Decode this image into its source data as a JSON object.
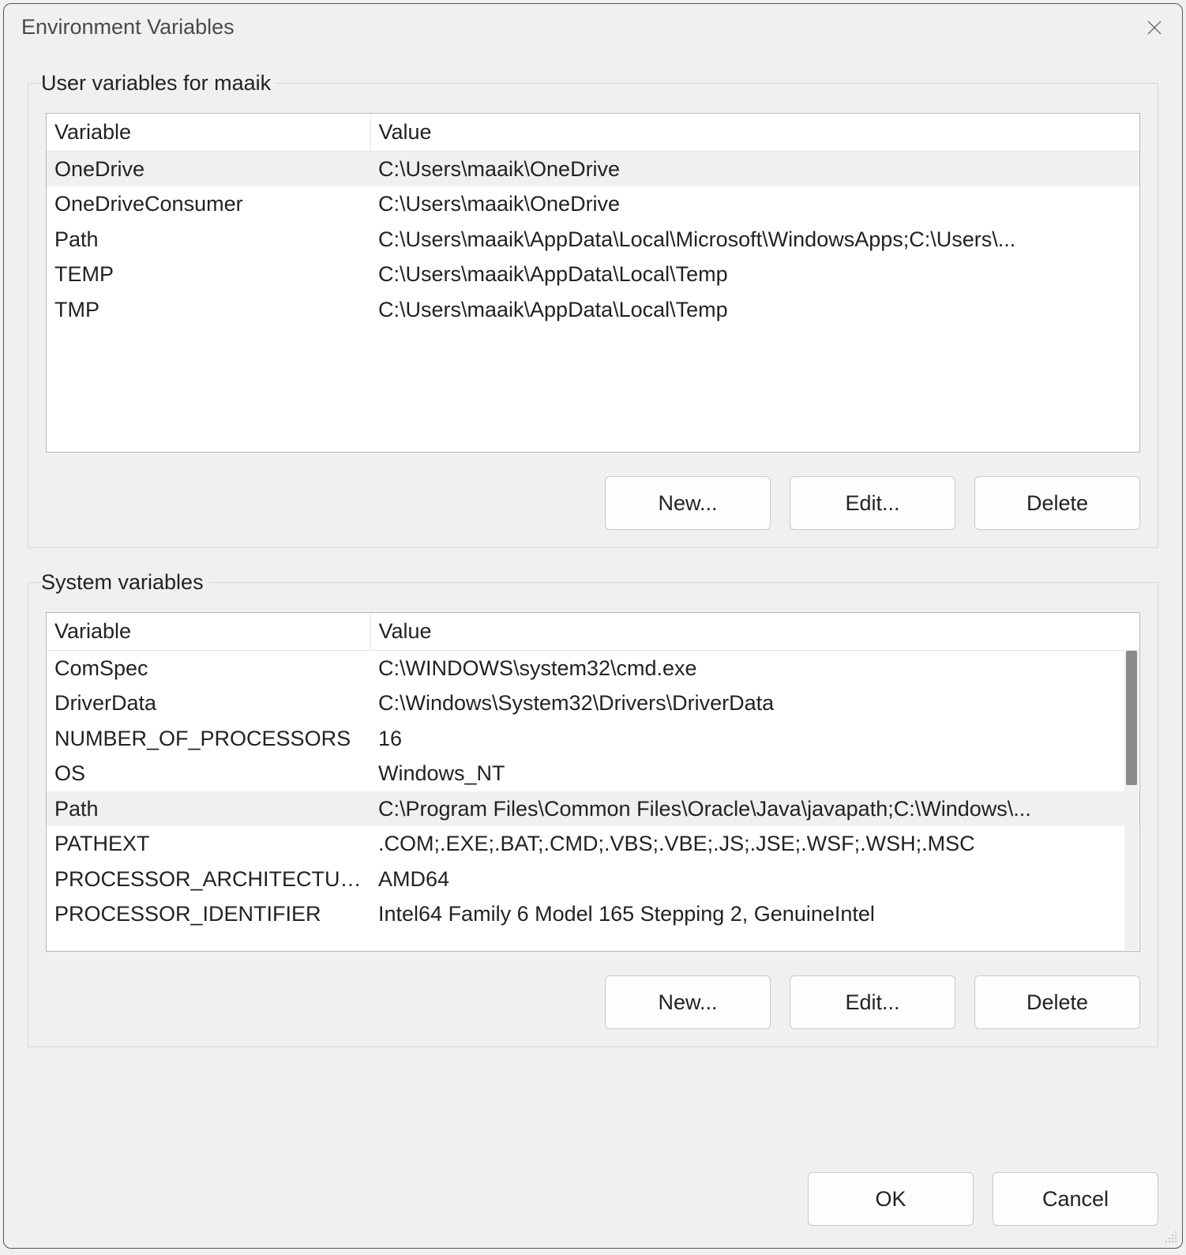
{
  "dialog": {
    "title": "Environment Variables"
  },
  "user_section": {
    "legend": "User variables for maaik",
    "columns": {
      "variable": "Variable",
      "value": "Value"
    },
    "rows": [
      {
        "variable": "OneDrive",
        "value": "C:\\Users\\maaik\\OneDrive",
        "selected": true
      },
      {
        "variable": "OneDriveConsumer",
        "value": "C:\\Users\\maaik\\OneDrive",
        "selected": false
      },
      {
        "variable": "Path",
        "value": "C:\\Users\\maaik\\AppData\\Local\\Microsoft\\WindowsApps;C:\\Users\\...",
        "selected": false
      },
      {
        "variable": "TEMP",
        "value": "C:\\Users\\maaik\\AppData\\Local\\Temp",
        "selected": false
      },
      {
        "variable": "TMP",
        "value": "C:\\Users\\maaik\\AppData\\Local\\Temp",
        "selected": false
      }
    ],
    "buttons": {
      "new": "New...",
      "edit": "Edit...",
      "delete": "Delete"
    }
  },
  "system_section": {
    "legend": "System variables",
    "columns": {
      "variable": "Variable",
      "value": "Value"
    },
    "rows": [
      {
        "variable": "ComSpec",
        "value": "C:\\WINDOWS\\system32\\cmd.exe",
        "selected": false
      },
      {
        "variable": "DriverData",
        "value": "C:\\Windows\\System32\\Drivers\\DriverData",
        "selected": false
      },
      {
        "variable": "NUMBER_OF_PROCESSORS",
        "value": "16",
        "selected": false
      },
      {
        "variable": "OS",
        "value": "Windows_NT",
        "selected": false
      },
      {
        "variable": "Path",
        "value": "C:\\Program Files\\Common Files\\Oracle\\Java\\javapath;C:\\Windows\\...",
        "selected": true
      },
      {
        "variable": "PATHEXT",
        "value": ".COM;.EXE;.BAT;.CMD;.VBS;.VBE;.JS;.JSE;.WSF;.WSH;.MSC",
        "selected": false
      },
      {
        "variable": "PROCESSOR_ARCHITECTURE",
        "value": "AMD64",
        "selected": false
      },
      {
        "variable": "PROCESSOR_IDENTIFIER",
        "value": "Intel64 Family 6 Model 165 Stepping 2, GenuineIntel",
        "selected": false
      }
    ],
    "buttons": {
      "new": "New...",
      "edit": "Edit...",
      "delete": "Delete"
    }
  },
  "footer": {
    "ok": "OK",
    "cancel": "Cancel"
  }
}
